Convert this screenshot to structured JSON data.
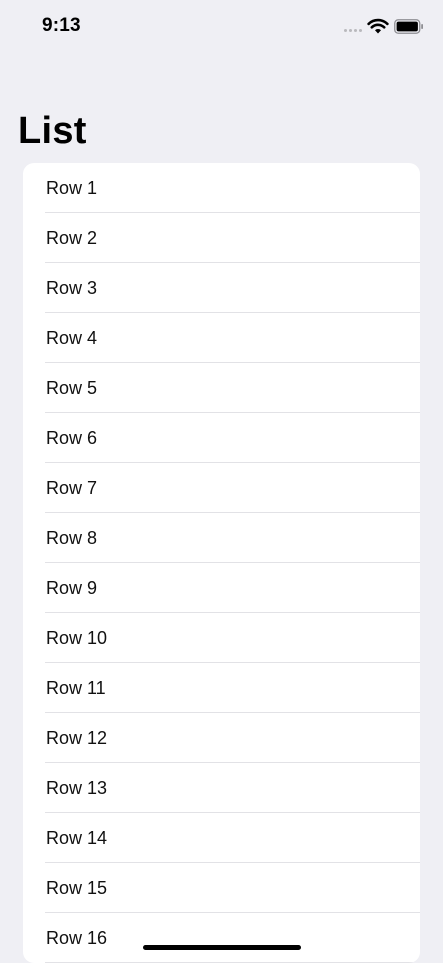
{
  "status_bar": {
    "time": "9:13",
    "wifi_icon": "wifi-icon",
    "battery_icon": "battery-icon"
  },
  "header": {
    "title": "List"
  },
  "list": {
    "rows": [
      {
        "label": "Row 1"
      },
      {
        "label": "Row 2"
      },
      {
        "label": "Row 3"
      },
      {
        "label": "Row 4"
      },
      {
        "label": "Row 5"
      },
      {
        "label": "Row 6"
      },
      {
        "label": "Row 7"
      },
      {
        "label": "Row 8"
      },
      {
        "label": "Row 9"
      },
      {
        "label": "Row 10"
      },
      {
        "label": "Row 11"
      },
      {
        "label": "Row 12"
      },
      {
        "label": "Row 13"
      },
      {
        "label": "Row 14"
      },
      {
        "label": "Row 15"
      },
      {
        "label": "Row 16"
      }
    ]
  },
  "colors": {
    "background": "#efeff4",
    "card": "#ffffff",
    "separator": "#e2e2e6"
  }
}
